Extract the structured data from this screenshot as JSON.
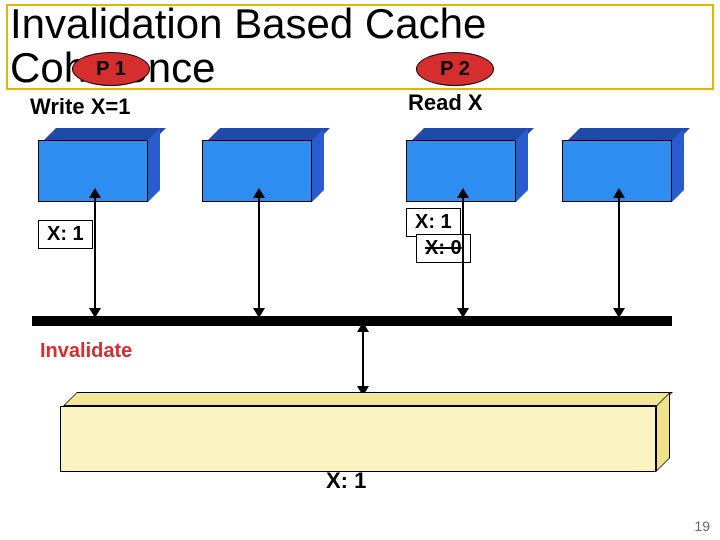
{
  "title_line1": "Invalidation Based Cache",
  "title_line2": "Coherence",
  "processors": {
    "p1": {
      "label": "P 1",
      "action": "Write X=1",
      "cache_tag": "X: 1"
    },
    "p2": {
      "label": "P 2",
      "action": "Read X",
      "cache_tag_new": "X: 1",
      "cache_tag_old": "X: 0"
    }
  },
  "bus_label": "Invalidate",
  "memory_value": "X: 1",
  "page_number": "19"
}
